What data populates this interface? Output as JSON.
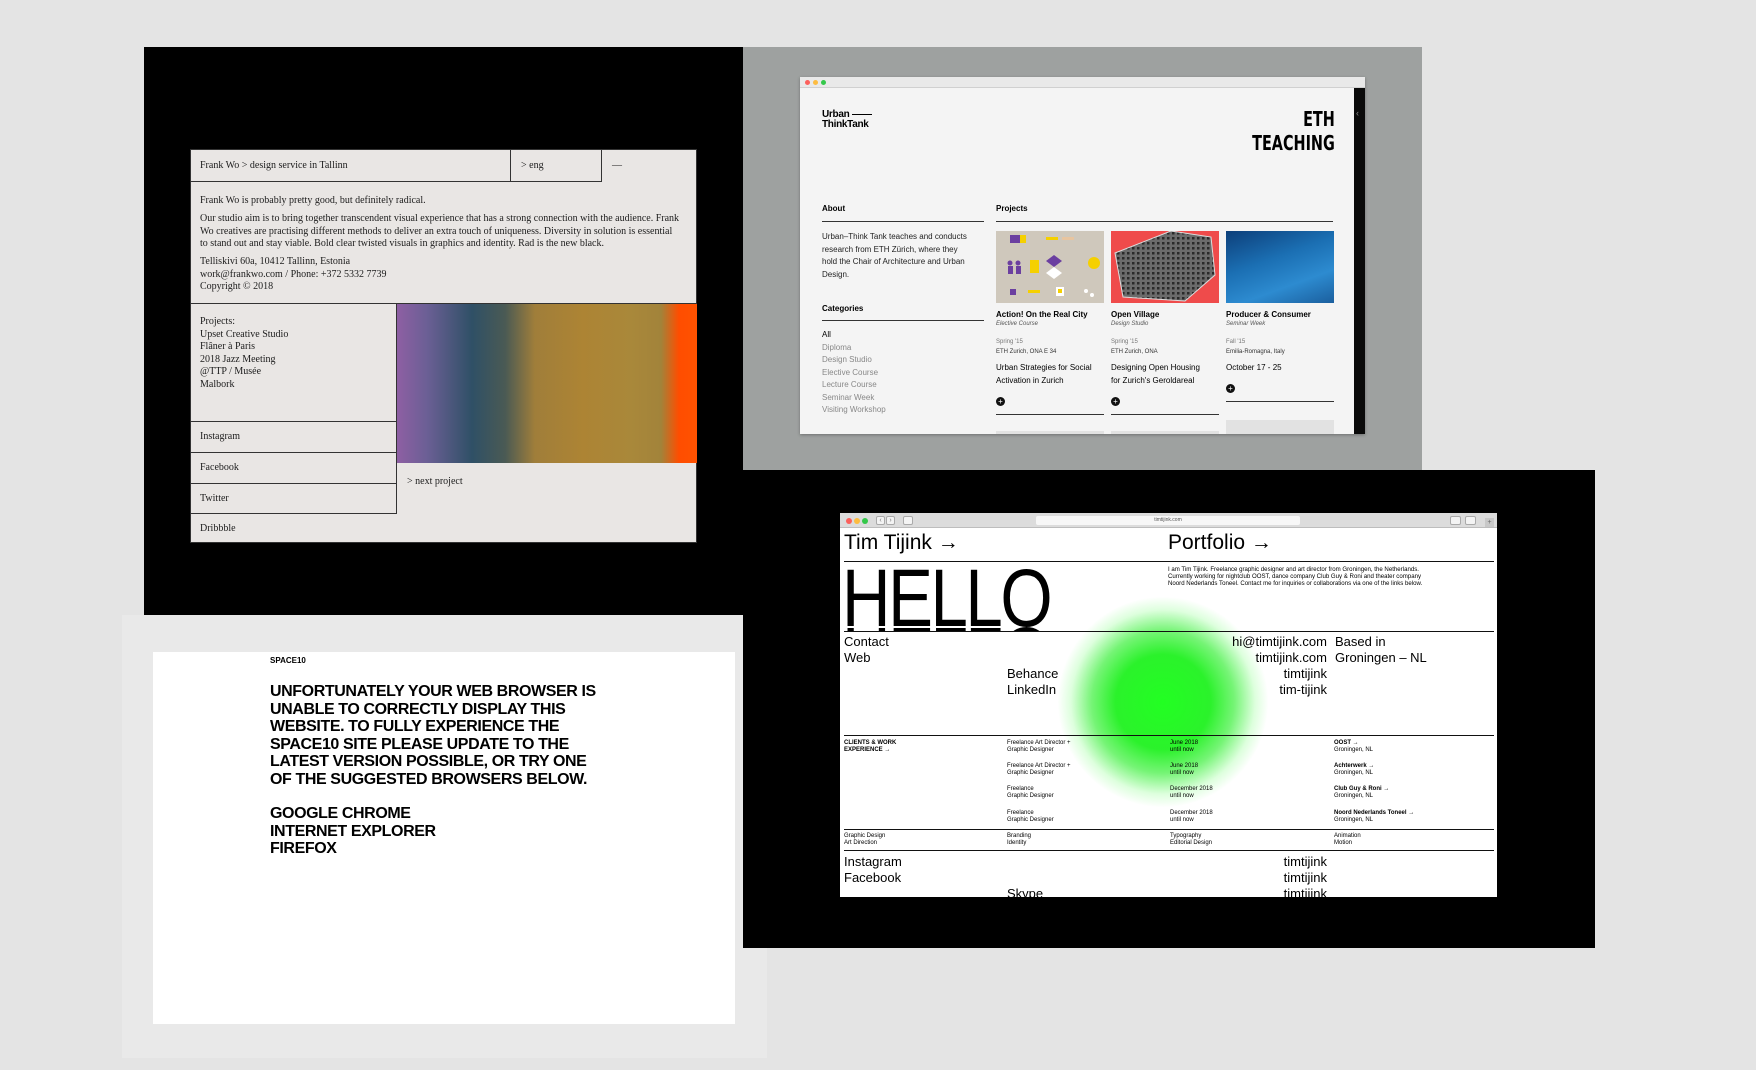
{
  "frankwo": {
    "breadcrumb": "Frank Wo > design service in Tallinn",
    "lang": "> eng",
    "dash": "—",
    "tagline": "Frank Wo is probably pretty good, but definitely radical.",
    "about_lines": [
      "Our studio aim is to bring together transcendent visual experience that has a strong connection with the audience. Frank",
      "Wo creatives are practising different methods to deliver an extra touch of uniqueness. Diversity in solution is essential",
      "to stand out and stay viable. Bold clear twisted visuals in graphics and identity. Rad is the new black."
    ],
    "address": "Telliskivi 60a, 10412 Tallinn, Estonia",
    "contact": "work@frankwo.com / Phone: +372 5332 7739",
    "copyright": "Copyright © 2018",
    "projects_label": "Projects:",
    "projects": [
      "Upset Creative Studio",
      "Flâner à Paris",
      "2018 Jazz Meeting",
      "@TTP / Musée",
      "Malbork"
    ],
    "social": [
      "Instagram",
      "Facebook",
      "Twitter",
      "Dribbble"
    ],
    "next": "> next project",
    "gradient_colors": [
      "#8e5fa3",
      "#2f5066",
      "#ad8434",
      "#ff5200"
    ]
  },
  "eth": {
    "logo_line1": "Urban",
    "logo_line2": "ThinkTank",
    "title_line1": "ETH",
    "title_line2": "TEACHING",
    "about_heading": "About",
    "about_lines": [
      "Urban–Think Tank teaches and conducts",
      "research from ETH Zürich, where they",
      "hold the Chair of Architecture and Urban",
      "Design."
    ],
    "categories_heading": "Categories",
    "categories": [
      "All",
      "Diploma",
      "Design Studio",
      "Elective Course",
      "Lecture Course",
      "Seminar Week",
      "Visiting Workshop"
    ],
    "projects_heading": "Projects",
    "projects": [
      {
        "title": "Action! On the Real City",
        "type": "Elective Course",
        "term": "Spring '15",
        "place": "ETH Zurich, ONA E 34",
        "desc1": "Urban Strategies for Social",
        "desc2": "Activation in Zurich",
        "thumb_color": "#cfc8bc"
      },
      {
        "title": "Open Village",
        "type": "Design Studio",
        "term": "Spring '15",
        "place": "ETH Zurich, ONA",
        "desc1": "Designing Open Housing",
        "desc2": "for Zurich's Geroldareal",
        "thumb_color": "#ef4b4b"
      },
      {
        "title": "Producer & Consumer",
        "type": "Seminar Week",
        "term": "Fall '15",
        "place": "Emilia-Romagna, Italy",
        "desc1": "October 17 - 25",
        "desc2": "",
        "thumb_color": "#1b6fb3"
      }
    ]
  },
  "space10": {
    "brand": "SPACE10",
    "message_lines": [
      "UNFORTUNATELY YOUR WEB BROWSER IS",
      "UNABLE TO CORRECTLY DISPLAY THIS",
      "WEBSITE. TO FULLY EXPERIENCE THE",
      "SPACE10 SITE PLEASE UPDATE TO THE",
      "LATEST VERSION POSSIBLE, OR TRY ONE",
      "OF THE SUGGESTED BROWSERS BELOW."
    ],
    "browsers": [
      "GOOGLE CHROME",
      "INTERNET EXPLORER",
      "FIREFOX"
    ]
  },
  "timtijink": {
    "url": "timtijink.com",
    "name": "Tim Tijink →",
    "portfolio": "Portfolio →",
    "bio_lines": [
      "I am Tim Tijink. Freelance graphic designer and art director from Groningen, the Netherlands.",
      "Currently working for nightclub OOST, dance company Club Guy & Roni and theater company",
      "Noord Nederlands Toneel. Contact me for inquiries or collaborations via one of the links below."
    ],
    "hello": "HELLO",
    "contact_label": "Contact",
    "web_label": "Web",
    "email": "hi@timtijink.com",
    "website": "timtijink.com",
    "based_line1": "Based in",
    "based_line2": "Groningen – NL",
    "behance": "Behance",
    "linkedin": "LinkedIn",
    "behance_handle": "timtijink",
    "linkedin_handle": "tim-tijink",
    "clients_line1": "CLIENTS & WORK",
    "clients_line2": "EXPERIENCE →",
    "jobs": [
      {
        "role1": "Freelance Art Director +",
        "role2": "Graphic Designer",
        "date1": "June 2018",
        "date2": "until now",
        "client": "OOST →",
        "city": "Groningen, NL"
      },
      {
        "role1": "Freelance Art Director +",
        "role2": "Graphic Designer",
        "date1": "June 2018",
        "date2": "until now",
        "client": "Achterwerk →",
        "city": "Groningen, NL"
      },
      {
        "role1": "Freelance",
        "role2": "Graphic Designer",
        "date1": "December 2018",
        "date2": "until now",
        "client": "Club Guy & Roni →",
        "city": "Groningen, NL"
      },
      {
        "role1": "Freelance",
        "role2": "Graphic Designer",
        "date1": "December 2018",
        "date2": "until now",
        "client": "Noord Nederlands Toneel →",
        "city": "Groningen, NL"
      }
    ],
    "skills": [
      {
        "a": "Graphic Design",
        "b": "Art Direction"
      },
      {
        "a": "Branding",
        "b": "Identity"
      },
      {
        "a": "Typography",
        "b": "Editorial Design"
      },
      {
        "a": "Animation",
        "b": "Motion"
      }
    ],
    "socials": [
      {
        "name": "Instagram",
        "handle": "timtijink"
      },
      {
        "name": "Facebook",
        "handle": "timtijink"
      },
      {
        "name": "Skype",
        "handle": "timtijink"
      }
    ],
    "glow_color": "#22ff22"
  }
}
